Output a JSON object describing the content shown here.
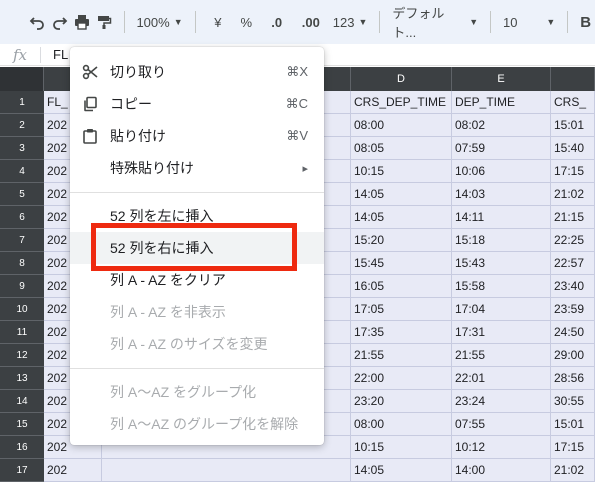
{
  "toolbar": {
    "undo_icon": "undo-icon",
    "redo_icon": "redo-icon",
    "print_icon": "print-icon",
    "paint_format_icon": "paint-format-icon",
    "zoom": "100%",
    "currency": "¥",
    "percent": "%",
    "decrease_decimal": ".0",
    "increase_decimal": ".00",
    "number_format": "123",
    "font": "デフォルト...",
    "font_size": "10",
    "bold": "B"
  },
  "formula_bar": {
    "fx": "fx",
    "value": "FL"
  },
  "columns": {
    "D": "D",
    "E": "E"
  },
  "rows": [
    {
      "num": "1",
      "a": "FL_",
      "d": "CRS_DEP_TIME",
      "e": "DEP_TIME",
      "f": "CRS_"
    },
    {
      "num": "2",
      "a": "202",
      "d": "08:00",
      "e": "08:02",
      "f": "15:01"
    },
    {
      "num": "3",
      "a": "202",
      "d": "08:05",
      "e": "07:59",
      "f": "15:40"
    },
    {
      "num": "4",
      "a": "202",
      "d": "10:15",
      "e": "10:06",
      "f": "17:15"
    },
    {
      "num": "5",
      "a": "202",
      "d": "14:05",
      "e": "14:03",
      "f": "21:02"
    },
    {
      "num": "6",
      "a": "202",
      "d": "14:05",
      "e": "14:11",
      "f": "21:15"
    },
    {
      "num": "7",
      "a": "202",
      "d": "15:20",
      "e": "15:18",
      "f": "22:25"
    },
    {
      "num": "8",
      "a": "202",
      "d": "15:45",
      "e": "15:43",
      "f": "22:57"
    },
    {
      "num": "9",
      "a": "202",
      "d": "16:05",
      "e": "15:58",
      "f": "23:40"
    },
    {
      "num": "10",
      "a": "202",
      "d": "17:05",
      "e": "17:04",
      "f": "23:59"
    },
    {
      "num": "11",
      "a": "202",
      "d": "17:35",
      "e": "17:31",
      "f": "24:50"
    },
    {
      "num": "12",
      "a": "202",
      "d": "21:55",
      "e": "21:55",
      "f": "29:00"
    },
    {
      "num": "13",
      "a": "202",
      "d": "22:00",
      "e": "22:01",
      "f": "28:56"
    },
    {
      "num": "14",
      "a": "202",
      "d": "23:20",
      "e": "23:24",
      "f": "30:55"
    },
    {
      "num": "15",
      "a": "202",
      "d": "08:00",
      "e": "07:55",
      "f": "15:01"
    },
    {
      "num": "16",
      "a": "202",
      "d": "10:15",
      "e": "10:12",
      "f": "17:15"
    },
    {
      "num": "17",
      "a": "202",
      "d": "14:05",
      "e": "14:00",
      "f": "21:02"
    }
  ],
  "context_menu": {
    "cut": {
      "label": "切り取り",
      "shortcut": "⌘X"
    },
    "copy": {
      "label": "コピー",
      "shortcut": "⌘C"
    },
    "paste": {
      "label": "貼り付け",
      "shortcut": "⌘V"
    },
    "paste_special": {
      "label": "特殊貼り付け",
      "arrow": "▸"
    },
    "insert_left": {
      "label": "52 列を左に挿入"
    },
    "insert_right": {
      "label": "52 列を右に挿入"
    },
    "clear": {
      "label": "列 A - AZ をクリア"
    },
    "hide": {
      "label": "列 A - AZ を非表示"
    },
    "resize": {
      "label": "列 A - AZ のサイズを変更"
    },
    "group": {
      "label": "列 A〜AZ をグループ化"
    },
    "ungroup": {
      "label": "列 A〜AZ のグループ化を解除"
    }
  },
  "colors": {
    "highlight_box": "#ee2a10",
    "selected_cells": "#e8eaf6",
    "header_dark": "#3c4043"
  }
}
